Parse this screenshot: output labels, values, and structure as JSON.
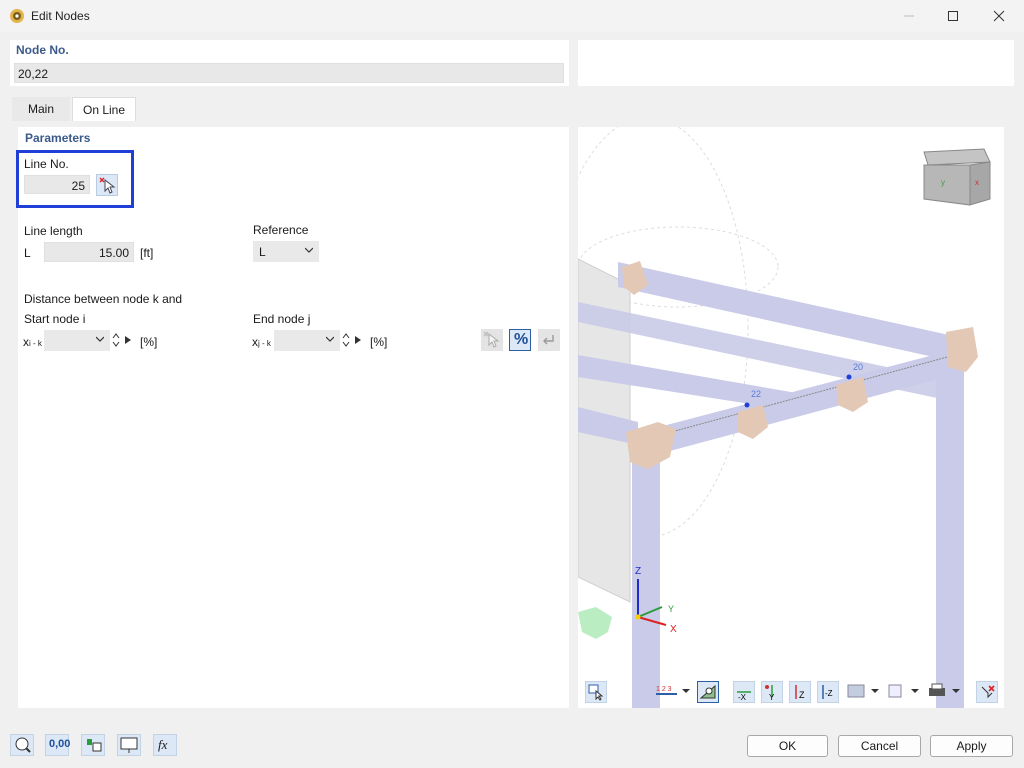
{
  "window": {
    "title": "Edit Nodes",
    "minimize_icon": "minimize-icon",
    "maximize_icon": "maximize-icon",
    "close_icon": "close-icon"
  },
  "node": {
    "label": "Node No.",
    "value": "20,22"
  },
  "tabs": [
    {
      "label": "Main"
    },
    {
      "label": "On Line"
    }
  ],
  "parameters": {
    "title": "Parameters",
    "line_no_label": "Line No.",
    "line_no_value": "25",
    "line_length_label": "Line length",
    "line_length_symbol": "L",
    "line_length_value": "15.00",
    "line_length_unit": "[ft]",
    "reference_label": "Reference",
    "reference_value": "L",
    "distance_label": "Distance between node k and",
    "start_node_label": "Start node i",
    "start_symbol_main": "x",
    "start_symbol_sub": "i - k",
    "start_unit": "[%]",
    "end_node_label": "End node j",
    "end_symbol_main": "x",
    "end_symbol_sub": "j - k",
    "end_unit": "[%]",
    "percent_label": "%"
  },
  "view": {
    "node_labels": [
      "20",
      "22"
    ],
    "axes": {
      "x": "X",
      "y": "Y",
      "z": "Z"
    },
    "toolbar_icons": [
      "view-select-icon",
      "numbering-icon",
      "show-icon",
      "view-x-icon",
      "view-y-icon",
      "view-z-icon",
      "view-iso-icon",
      "render-mode-icon",
      "display-mode-icon",
      "print-icon",
      "reset-icon"
    ],
    "toolbar_labels": {
      "x": "-X",
      "y": "Y",
      "z": "Z",
      "iso": "-Z"
    }
  },
  "footer": {
    "icons": [
      "help-icon",
      "units-icon",
      "model-icon",
      "display-icon",
      "formula-icon"
    ],
    "units_label": "0,00",
    "formula_label": "fx",
    "ok": "OK",
    "cancel": "Cancel",
    "apply": "Apply"
  },
  "colors": {
    "accent_blue": "#1f3fd6",
    "member_fill": "#c9cbe8",
    "support_fill": "#e3c9b5"
  }
}
